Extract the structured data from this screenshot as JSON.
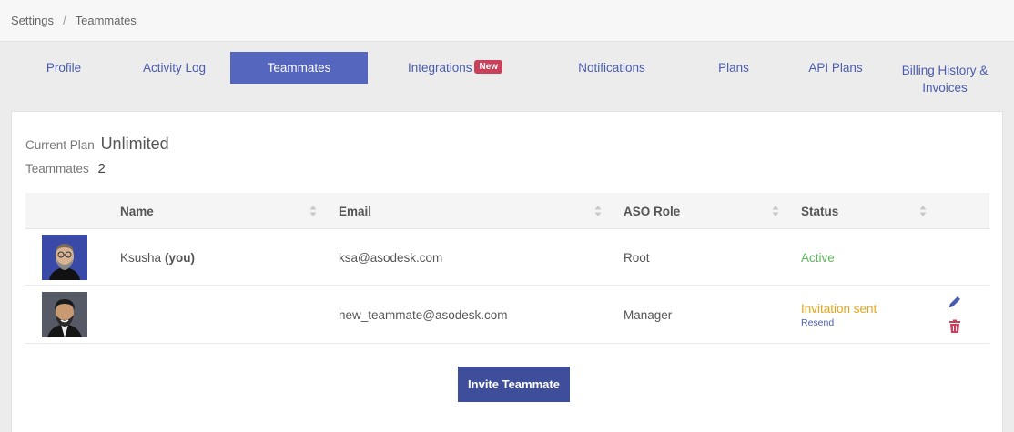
{
  "breadcrumb": {
    "items": [
      "Settings",
      "Teammates"
    ],
    "separator": "/"
  },
  "tabs": [
    {
      "label": "Profile"
    },
    {
      "label": "Activity Log"
    },
    {
      "label": "Teammates",
      "active": true
    },
    {
      "label": "Integrations",
      "badge": "New"
    },
    {
      "label": "Notifications"
    },
    {
      "label": "Plans"
    },
    {
      "label": "API Plans"
    },
    {
      "label_line1": "Billing History &",
      "label_line2": "Invoices"
    }
  ],
  "plan": {
    "label": "Current Plan",
    "value": "Unlimited"
  },
  "teammates_count": {
    "label": "Teammates",
    "value": "2"
  },
  "table": {
    "columns": [
      "Name",
      "Email",
      "ASO Role",
      "Status"
    ],
    "rows": [
      {
        "name": "Ksusha",
        "name_suffix": "(you)",
        "email": "ksa@asodesk.com",
        "role": "Root",
        "status": "Active"
      },
      {
        "name": "",
        "email": "new_teammate@asodesk.com",
        "role": "Manager",
        "status": "Invitation sent",
        "resend": "Resend"
      }
    ]
  },
  "invite_button": "Invite Teammate",
  "colors": {
    "accent": "#5466bd",
    "button": "#3f4e9a",
    "badge": "#c9405a",
    "active_status": "#5cb85c",
    "pending_status": "#e8a317",
    "delete": "#c9405a"
  }
}
